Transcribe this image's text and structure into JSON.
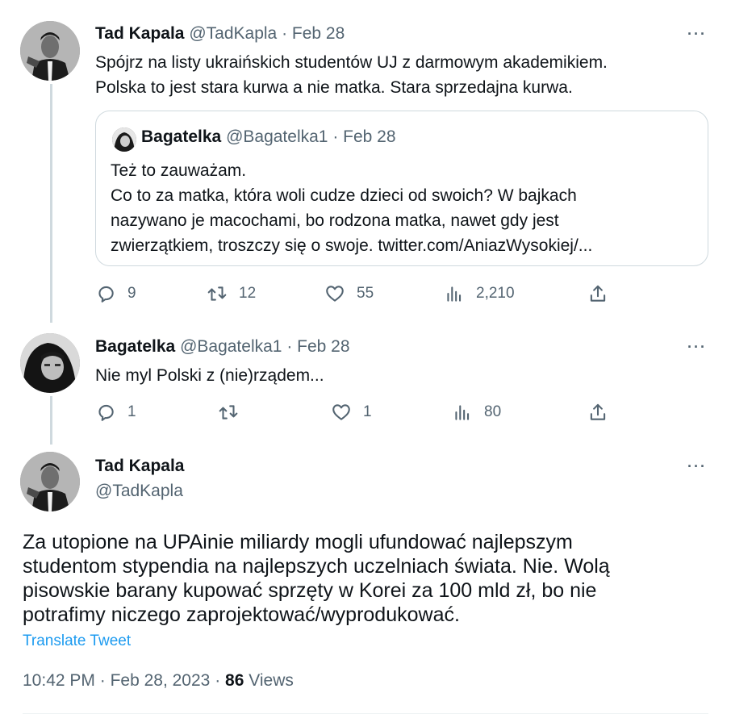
{
  "tweet1": {
    "name": "Tad Kapala",
    "handle": "@TadKapla",
    "separator": "·",
    "date": "Feb 28",
    "more": "···",
    "lines": [
      "Spójrz na listy ukraińskich studentów UJ z darmowym akademikiem.",
      "Polska to jest stara kurwa a nie matka. Stara sprzedajna kurwa."
    ],
    "quote": {
      "name": "Bagatelka",
      "handle": "@Bagatelka1",
      "separator": "·",
      "date": "Feb 28",
      "lines": [
        "Też to zauważam.",
        "Co to za matka, która woli cudze dzieci od swoich?  W bajkach",
        "nazywano je macochami, bo rodzona matka, nawet gdy jest",
        "zwierzątkiem, troszczy się o swoje. twitter.com/AniazWysokiej/..."
      ]
    },
    "actions": {
      "reply_count": "9",
      "retweet_count": "12",
      "like_count": "55",
      "views_count": "2,210"
    }
  },
  "tweet2": {
    "name": "Bagatelka",
    "handle": "@Bagatelka1",
    "separator": "·",
    "date": "Feb 28",
    "more": "···",
    "text": "Nie myl Polski z (nie)rządem...",
    "actions": {
      "reply_count": "1",
      "retweet_count": "",
      "like_count": "1",
      "views_count": "80"
    }
  },
  "main_tweet": {
    "name": "Tad Kapala",
    "handle": "@TadKapla",
    "more": "···",
    "lines": [
      "Za utopione  na UPAinie miliardy mogli ufundować najlepszym",
      "studentom stypendia na najlepszych uczelniach świata. Nie. Wolą",
      "pisowskie barany kupować sprzęty w Korei za 100 mld zł, bo nie",
      "potrafimy niczego zaprojektować/wyprodukować."
    ],
    "translate": "Translate Tweet",
    "time": "10:42 PM",
    "separator": "·",
    "date": "Feb 28, 2023",
    "views_count": "86",
    "views_label": "Views"
  }
}
